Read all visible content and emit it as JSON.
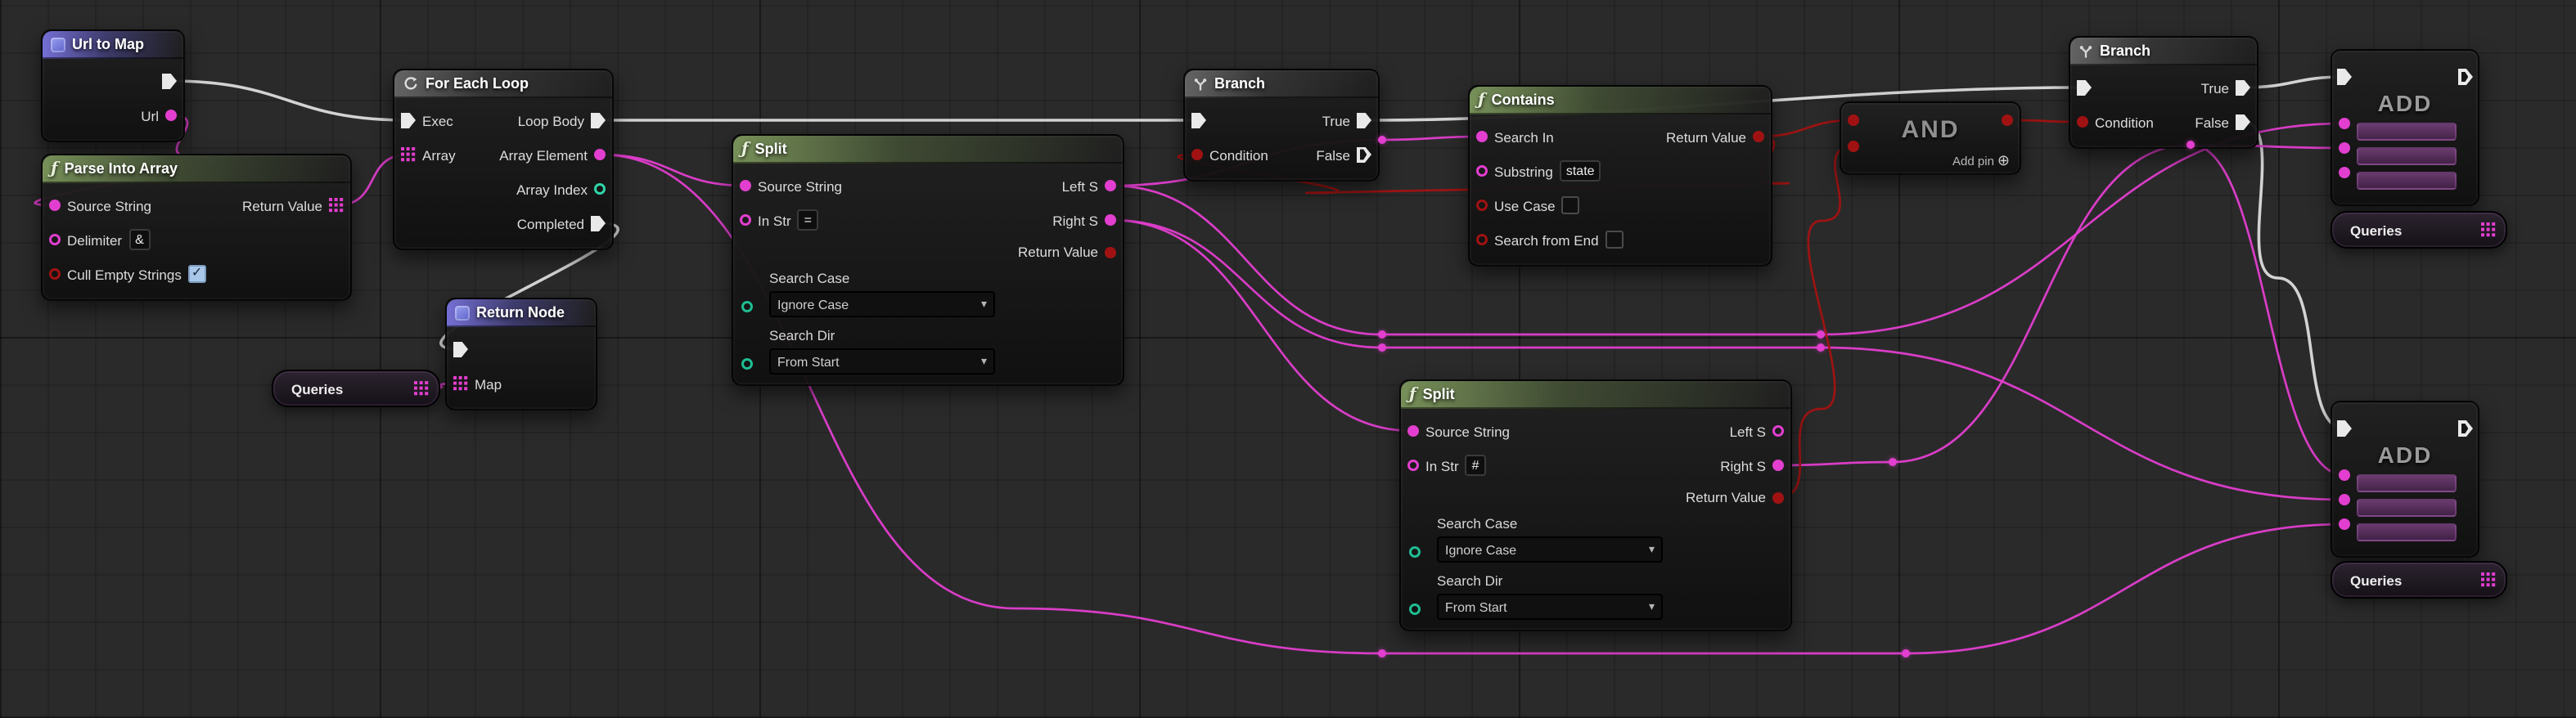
{
  "icons": {
    "fn": "ƒ",
    "chevron_down": "▾",
    "add_circle": "⊕"
  },
  "wire_colors": {
    "exec": "#dcdcdc",
    "str": "#e23ecf",
    "bool": "#a31212"
  },
  "graph": {
    "urlToMap": {
      "title": "Url to Map",
      "pin_url": "Url"
    },
    "parseIntoArray": {
      "title": "Parse Into Array",
      "pin_source": "Source String",
      "pin_return": "Return Value",
      "pin_delimiter": "Delimiter",
      "delimiter_value": "&",
      "pin_cull": "Cull Empty Strings"
    },
    "forEachLoop": {
      "title": "For Each Loop",
      "pin_exec": "Exec",
      "pin_loop_body": "Loop Body",
      "pin_array": "Array",
      "pin_array_element": "Array Element",
      "pin_array_index": "Array Index",
      "pin_completed": "Completed"
    },
    "returnNode": {
      "title": "Return Node",
      "pin_map": "Map"
    },
    "queries1": {
      "title": "Queries"
    },
    "split1": {
      "title": "Split",
      "pin_source": "Source String",
      "pin_in_str": "In Str",
      "in_str_value": "=",
      "pin_left": "Left S",
      "pin_right": "Right S",
      "pin_return": "Return Value",
      "label_search_case": "Search Case",
      "search_case_value": "Ignore Case",
      "label_search_dir": "Search Dir",
      "search_dir_value": "From Start"
    },
    "branch1": {
      "title": "Branch",
      "pin_condition": "Condition",
      "pin_true": "True",
      "pin_false": "False"
    },
    "contains": {
      "title": "Contains",
      "pin_search_in": "Search In",
      "pin_return": "Return Value",
      "pin_substring": "Substring",
      "substring_value": "state",
      "pin_use_case": "Use Case",
      "pin_search_from_end": "Search from End"
    },
    "andNode": {
      "title": "AND",
      "add_pin": "Add pin"
    },
    "branch2": {
      "title": "Branch",
      "pin_condition": "Condition",
      "pin_true": "True",
      "pin_false": "False"
    },
    "add1": {
      "title": "ADD"
    },
    "queries2": {
      "title": "Queries"
    },
    "split2": {
      "title": "Split",
      "pin_source": "Source String",
      "pin_in_str": "In Str",
      "in_str_value": "#",
      "pin_left": "Left S",
      "pin_right": "Right S",
      "pin_return": "Return Value",
      "label_search_case": "Search Case",
      "search_case_value": "Ignore Case",
      "label_search_dir": "Search Dir",
      "search_dir_value": "From Start"
    },
    "add2": {
      "title": "ADD"
    },
    "queries3": {
      "title": "Queries"
    }
  },
  "wires": [
    {
      "c": "exec",
      "pts": [
        "u2m.exec",
        "fel.exec"
      ]
    },
    {
      "c": "exec",
      "pts": [
        "fel.body",
        "br1.exec"
      ]
    },
    {
      "c": "exec",
      "pts": [
        "fel.done",
        "ret.exec"
      ]
    },
    {
      "c": "exec",
      "pts": [
        "br1.true",
        "br2.exec"
      ]
    },
    {
      "c": "exec",
      "pts": [
        "br2.true",
        "add1.exec"
      ]
    },
    {
      "c": "exec",
      "pts": [
        "br2.false",
        [
          1392,
          170
        ],
        "add2.exec"
      ]
    },
    {
      "c": "str",
      "pts": [
        "u2m.url",
        [
          118,
          96
        ],
        "pia.src"
      ]
    },
    {
      "c": "str",
      "pts": [
        "pia.ret",
        "fel.array"
      ]
    },
    {
      "c": "str",
      "pts": [
        "fel.elem",
        "sp1.src"
      ]
    },
    {
      "c": "str",
      "pts": [
        "sp1.left",
        "r1",
        "con.in"
      ]
    },
    {
      "c": "str",
      "pts": [
        "sp1.right",
        "sp2.src"
      ]
    },
    {
      "c": "str",
      "pts": [
        "sp1.left",
        "r2",
        "r4",
        "add1.p1"
      ]
    },
    {
      "c": "str",
      "pts": [
        "sp1.right",
        "r3",
        "r5",
        "add2.p2"
      ]
    },
    {
      "c": "str",
      "pts": [
        "sp2.right",
        "r8",
        "r9",
        "add1.p2"
      ]
    },
    {
      "c": "str",
      "pts": [
        "r9",
        "add2.p1"
      ]
    },
    {
      "c": "str",
      "pts": [
        "fel.elem",
        [
          620,
          372
        ],
        "r6",
        "r7",
        "add2.p3"
      ]
    },
    {
      "c": "str",
      "pts": [
        "q1.pin",
        "ret.map"
      ]
    },
    {
      "c": "bool",
      "pts": [
        "con.ret",
        "and.a"
      ]
    },
    {
      "c": "bool",
      "pts": [
        "sp2.ret",
        [
          1113,
          250
        ],
        [
          1113,
          135
        ],
        "and.b"
      ]
    },
    {
      "c": "bool",
      "pts": [
        "and.out",
        "br2.cond"
      ]
    },
    {
      "c": "bool",
      "pts": [
        "con.ret",
        [
          1085,
          112
        ],
        [
          806,
          118
        ],
        "br1.cond"
      ]
    }
  ]
}
